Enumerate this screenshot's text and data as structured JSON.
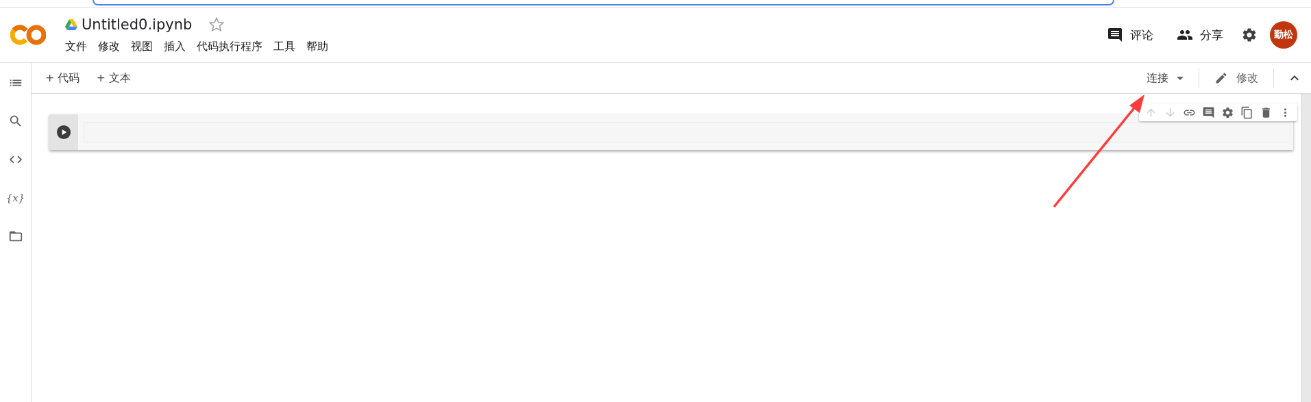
{
  "notebook": {
    "title": "Untitled0.ipynb",
    "starred": false
  },
  "menu": [
    "文件",
    "修改",
    "视图",
    "插入",
    "代码执行程序",
    "工具",
    "帮助"
  ],
  "header_actions": [
    {
      "kind": "comment",
      "label": "评论"
    },
    {
      "kind": "share",
      "label": "分享"
    }
  ],
  "avatar": {
    "initials": "勤松"
  },
  "sidebar": [
    {
      "kind": "toc"
    },
    {
      "kind": "search"
    },
    {
      "kind": "code"
    },
    {
      "kind": "variables",
      "glyph": "{x}"
    },
    {
      "kind": "files"
    }
  ],
  "toolbar": {
    "add_buttons": [
      "+ 代码",
      "+ 文本"
    ],
    "connect": "连接",
    "edit": "修改"
  },
  "cell_toolbar": [
    {
      "kind": "up",
      "disabled": true
    },
    {
      "kind": "down",
      "disabled": true
    },
    {
      "kind": "link",
      "disabled": false
    },
    {
      "kind": "comment",
      "disabled": false
    },
    {
      "kind": "settings",
      "disabled": false
    },
    {
      "kind": "mirror",
      "disabled": false
    },
    {
      "kind": "delete",
      "disabled": false
    },
    {
      "kind": "more",
      "disabled": false
    }
  ]
}
